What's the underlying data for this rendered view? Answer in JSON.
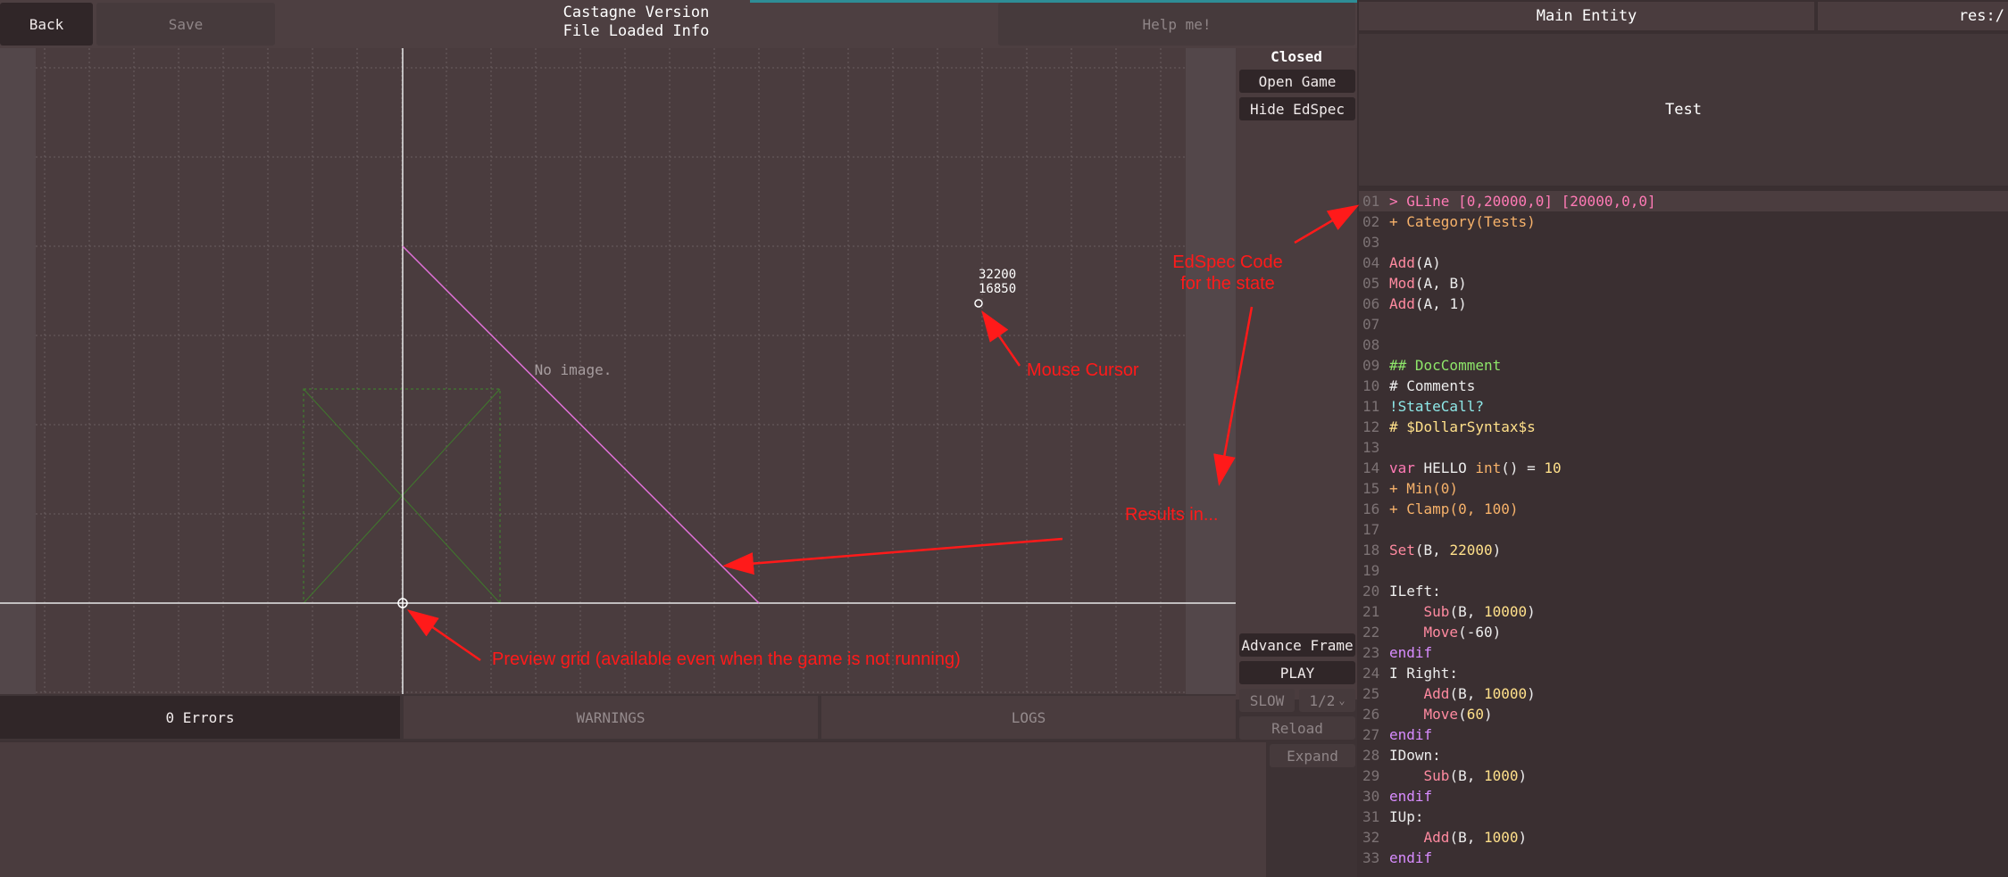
{
  "toolbar": {
    "back_label": "Back",
    "save_label": "Save",
    "version_label": "Castagne Version",
    "file_info_label": "File Loaded Info",
    "help_label": "Help me!"
  },
  "side": {
    "closed_label": "Closed",
    "open_game_label": "Open Game",
    "hide_edspec_label": "Hide EdSpec",
    "advance_frame_label": "Advance Frame",
    "play_label": "PLAY",
    "slow_label": "SLOW",
    "speed_value": "1/2",
    "reload_label": "Reload",
    "expand_label": "Expand"
  },
  "viewport": {
    "no_image_label": "No image.",
    "cursor_x": "32200",
    "cursor_y": "16850"
  },
  "tabs": {
    "errors_label": "0 Errors",
    "warnings_label": "WARNINGS",
    "logs_label": "LOGS"
  },
  "right": {
    "entity_tab_label": "Main Entity",
    "res_tab_label": "res:/",
    "test_label": "Test"
  },
  "code_lines": [
    {
      "n": "01",
      "segs": [
        {
          "t": "> GLine [0,20000,0] [20000,0,0]",
          "c": "k-pink"
        }
      ]
    },
    {
      "n": "02",
      "segs": [
        {
          "t": "+ Category(Tests)",
          "c": "k-orange"
        }
      ]
    },
    {
      "n": "03",
      "segs": []
    },
    {
      "n": "04",
      "segs": [
        {
          "t": "Add",
          "c": "k-fn"
        },
        {
          "t": "(A)",
          "c": "k-white"
        }
      ]
    },
    {
      "n": "05",
      "segs": [
        {
          "t": "Mod",
          "c": "k-fn"
        },
        {
          "t": "(A, B)",
          "c": "k-white"
        }
      ]
    },
    {
      "n": "06",
      "segs": [
        {
          "t": "Add",
          "c": "k-fn"
        },
        {
          "t": "(A, 1)",
          "c": "k-white"
        }
      ]
    },
    {
      "n": "07",
      "segs": []
    },
    {
      "n": "08",
      "segs": []
    },
    {
      "n": "09",
      "segs": [
        {
          "t": "## DocComment",
          "c": "k-green"
        }
      ]
    },
    {
      "n": "10",
      "segs": [
        {
          "t": "# Comments",
          "c": "k-white"
        }
      ]
    },
    {
      "n": "11",
      "segs": [
        {
          "t": "!StateCall?",
          "c": "k-cyan"
        }
      ]
    },
    {
      "n": "12",
      "segs": [
        {
          "t": "# $DollarSyntax$s",
          "c": "k-yellow"
        }
      ]
    },
    {
      "n": "13",
      "segs": []
    },
    {
      "n": "14",
      "segs": [
        {
          "t": "var",
          "c": "k-pink"
        },
        {
          "t": " HELLO ",
          "c": "k-white"
        },
        {
          "t": "int",
          "c": "k-orange"
        },
        {
          "t": "() = ",
          "c": "k-white"
        },
        {
          "t": "10",
          "c": "k-yellow"
        }
      ]
    },
    {
      "n": "15",
      "segs": [
        {
          "t": "+ Min(0)",
          "c": "k-orange"
        }
      ]
    },
    {
      "n": "16",
      "segs": [
        {
          "t": "+ Clamp(0, 100)",
          "c": "k-orange"
        }
      ]
    },
    {
      "n": "17",
      "segs": []
    },
    {
      "n": "18",
      "segs": [
        {
          "t": "Set",
          "c": "k-fn"
        },
        {
          "t": "(B, ",
          "c": "k-white"
        },
        {
          "t": "22000",
          "c": "k-yellow"
        },
        {
          "t": ")",
          "c": "k-white"
        }
      ]
    },
    {
      "n": "19",
      "segs": []
    },
    {
      "n": "20",
      "segs": [
        {
          "t": "ILeft:",
          "c": "k-white"
        }
      ]
    },
    {
      "n": "21",
      "segs": [
        {
          "t": "    ",
          "c": "k-white"
        },
        {
          "t": "Sub",
          "c": "k-fn"
        },
        {
          "t": "(B, ",
          "c": "k-white"
        },
        {
          "t": "10000",
          "c": "k-yellow"
        },
        {
          "t": ")",
          "c": "k-white"
        }
      ]
    },
    {
      "n": "22",
      "segs": [
        {
          "t": "    ",
          "c": "k-white"
        },
        {
          "t": "Move",
          "c": "k-fn"
        },
        {
          "t": "(-60)",
          "c": "k-white"
        }
      ]
    },
    {
      "n": "23",
      "segs": [
        {
          "t": "endif",
          "c": "k-purple"
        }
      ]
    },
    {
      "n": "24",
      "segs": [
        {
          "t": "I Right:",
          "c": "k-white"
        }
      ]
    },
    {
      "n": "25",
      "segs": [
        {
          "t": "    ",
          "c": "k-white"
        },
        {
          "t": "Add",
          "c": "k-fn"
        },
        {
          "t": "(B, ",
          "c": "k-white"
        },
        {
          "t": "10000",
          "c": "k-yellow"
        },
        {
          "t": ")",
          "c": "k-white"
        }
      ]
    },
    {
      "n": "26",
      "segs": [
        {
          "t": "    ",
          "c": "k-white"
        },
        {
          "t": "Move",
          "c": "k-fn"
        },
        {
          "t": "(",
          "c": "k-white"
        },
        {
          "t": "60",
          "c": "k-yellow"
        },
        {
          "t": ")",
          "c": "k-white"
        }
      ]
    },
    {
      "n": "27",
      "segs": [
        {
          "t": "endif",
          "c": "k-purple"
        }
      ]
    },
    {
      "n": "28",
      "segs": [
        {
          "t": "IDown:",
          "c": "k-white"
        }
      ]
    },
    {
      "n": "29",
      "segs": [
        {
          "t": "    ",
          "c": "k-white"
        },
        {
          "t": "Sub",
          "c": "k-fn"
        },
        {
          "t": "(B, ",
          "c": "k-white"
        },
        {
          "t": "1000",
          "c": "k-yellow"
        },
        {
          "t": ")",
          "c": "k-white"
        }
      ]
    },
    {
      "n": "30",
      "segs": [
        {
          "t": "endif",
          "c": "k-purple"
        }
      ]
    },
    {
      "n": "31",
      "segs": [
        {
          "t": "IUp:",
          "c": "k-white"
        }
      ]
    },
    {
      "n": "32",
      "segs": [
        {
          "t": "    ",
          "c": "k-white"
        },
        {
          "t": "Add",
          "c": "k-fn"
        },
        {
          "t": "(B, ",
          "c": "k-white"
        },
        {
          "t": "1000",
          "c": "k-yellow"
        },
        {
          "t": ")",
          "c": "k-white"
        }
      ]
    },
    {
      "n": "33",
      "segs": [
        {
          "t": "endif",
          "c": "k-purple"
        }
      ]
    }
  ],
  "annotations": {
    "edspec_line1": "EdSpec Code",
    "edspec_line2": "for the state",
    "mouse_cursor": "Mouse Cursor",
    "results": "Results in...",
    "preview_grid": "Preview grid (available even when the game is not running)"
  },
  "colors": {
    "accent_stripe": "#2e8d96",
    "annotation_red": "#ff1a1a",
    "gline_pink": "#ff7ab5"
  }
}
